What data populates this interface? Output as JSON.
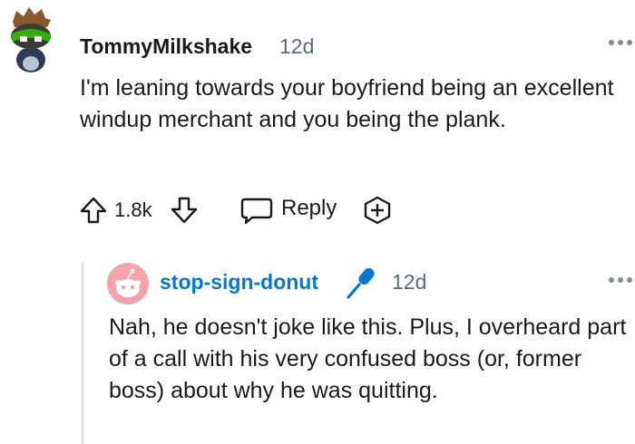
{
  "comment": {
    "author": "TommyMilkshake",
    "time": "12d",
    "body": "I'm leaning towards your boyfriend being an excellent windup merchant and you being the plank.",
    "score": "1.8k",
    "reply_label": "Reply",
    "avatar_icon": "snoo-avatar-icon"
  },
  "reply": {
    "author": "stop-sign-donut",
    "time": "12d",
    "body": "Nah, he doesn't joke like this. Plus, I overheard part of a call with his very confused boss (or, former boss) about why he was quitting.",
    "author_color": "#0079d3",
    "badge_icon": "microphone-icon"
  },
  "colors": {
    "text": "#1a1a1b",
    "meta": "#576f76",
    "link": "#0079d3",
    "thread_line": "#dadada"
  }
}
